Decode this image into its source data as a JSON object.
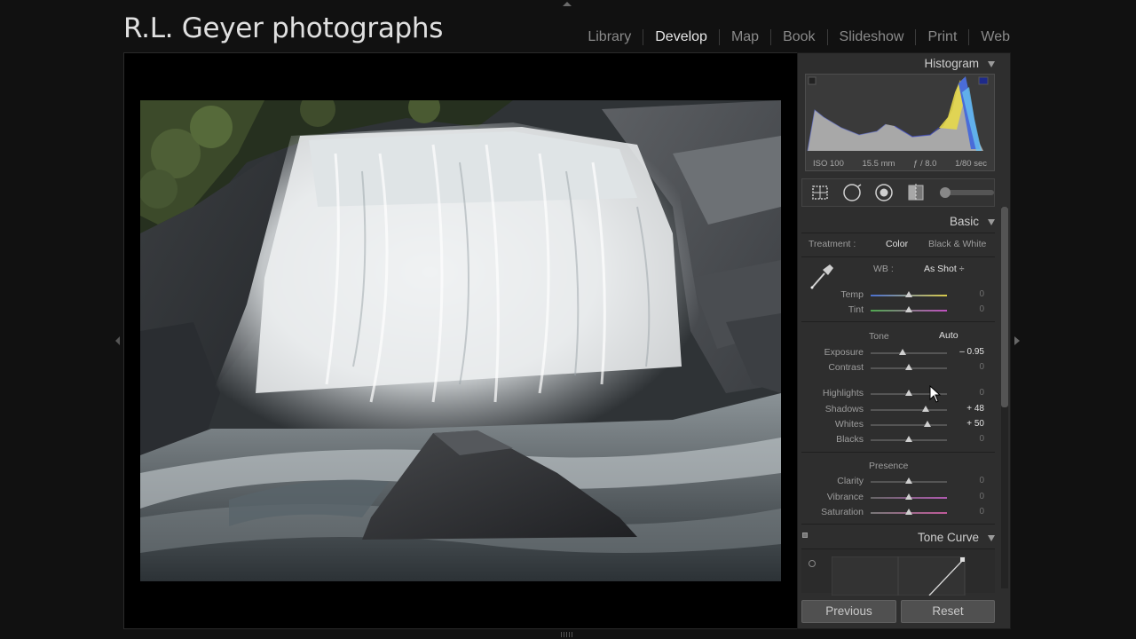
{
  "identity_plate": "R.L. Geyer photographs",
  "modules": [
    {
      "label": "Library",
      "active": false
    },
    {
      "label": "Develop",
      "active": true
    },
    {
      "label": "Map",
      "active": false
    },
    {
      "label": "Book",
      "active": false
    },
    {
      "label": "Slideshow",
      "active": false
    },
    {
      "label": "Print",
      "active": false
    },
    {
      "label": "Web",
      "active": false
    }
  ],
  "histogram": {
    "title": "Histogram",
    "iso": "ISO 100",
    "focal": "15.5 mm",
    "aperture": "ƒ / 8.0",
    "shutter": "1/80 sec"
  },
  "tools": [
    "crop-overlay-icon",
    "spot-removal-icon",
    "red-eye-icon",
    "graduated-filter-icon"
  ],
  "basic": {
    "title": "Basic",
    "treatment_label": "Treatment :",
    "treatment_color": "Color",
    "treatment_bw": "Black & White",
    "wb_label": "WB :",
    "wb_value": "As Shot ÷",
    "wb_sliders": [
      {
        "name": "Temp",
        "value": "0",
        "pos": 0.5,
        "active": false
      },
      {
        "name": "Tint",
        "value": "0",
        "pos": 0.5,
        "active": false
      }
    ],
    "tone_label": "Tone",
    "auto_label": "Auto",
    "tone_sliders": [
      {
        "name": "Exposure",
        "value": "– 0.95",
        "pos": 0.42,
        "active": true
      },
      {
        "name": "Contrast",
        "value": "0",
        "pos": 0.5,
        "active": false
      },
      {
        "name": "Highlights",
        "value": "0",
        "pos": 0.5,
        "active": false
      },
      {
        "name": "Shadows",
        "value": "+ 48",
        "pos": 0.72,
        "active": true
      },
      {
        "name": "Whites",
        "value": "+ 50",
        "pos": 0.74,
        "active": true
      },
      {
        "name": "Blacks",
        "value": "0",
        "pos": 0.5,
        "active": false
      }
    ],
    "presence_label": "Presence",
    "presence_sliders": [
      {
        "name": "Clarity",
        "value": "0",
        "pos": 0.5,
        "active": false
      },
      {
        "name": "Vibrance",
        "value": "0",
        "pos": 0.5,
        "active": false
      },
      {
        "name": "Saturation",
        "value": "0",
        "pos": 0.5,
        "active": false
      }
    ]
  },
  "tone_curve": {
    "title": "Tone Curve"
  },
  "buttons": {
    "previous": "Previous",
    "reset": "Reset"
  },
  "colors": {
    "accent": "#e6e6e6",
    "panel_bg": "#2e2e2e",
    "background": "#111111"
  }
}
